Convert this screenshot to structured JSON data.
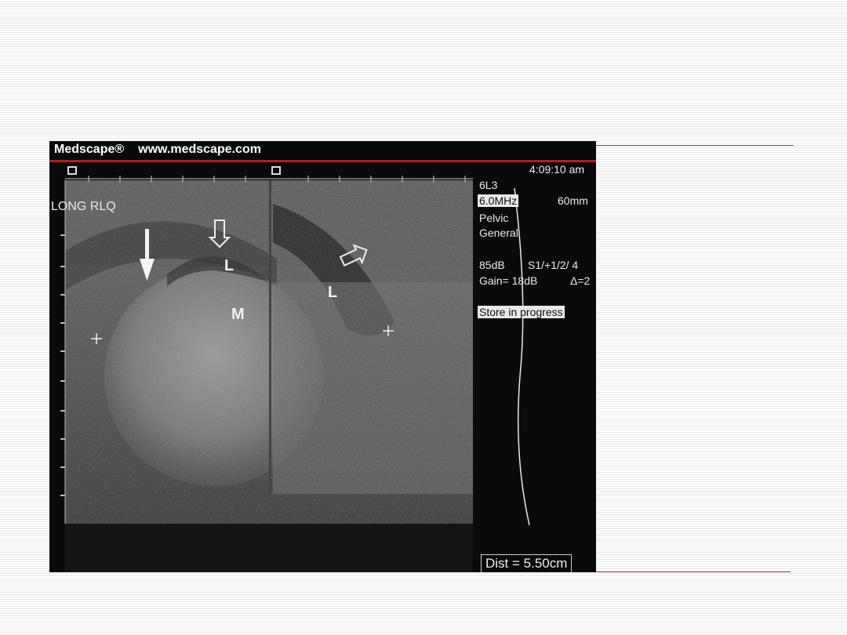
{
  "header": {
    "brand": "Medscape®",
    "url": "www.medscape.com"
  },
  "overlay": {
    "time": "4:09:10 am",
    "probe": "6L3",
    "frequency": "6.0MHz",
    "depth": "60mm",
    "preset_line1": "Pelvic",
    "preset_line2": "General",
    "power": "85dB",
    "settings": "S1/+1/2/ 4",
    "gain": "Gain= 18dB",
    "delta": "Δ=2",
    "status": "Store in progress",
    "location": "LONG RLQ",
    "distance": "Dist = 5.50cm"
  },
  "labels": {
    "left_l": "L",
    "right_l": "L",
    "mass": "M"
  },
  "colors": {
    "rule": "#b03030",
    "frame": "#0a0a0a",
    "overlay_text": "#eaeaea"
  }
}
